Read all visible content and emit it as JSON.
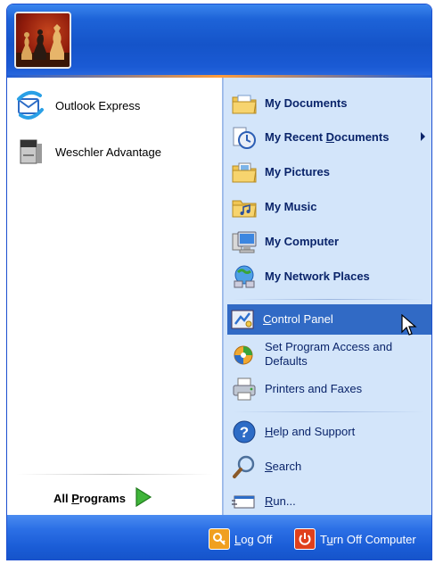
{
  "pinned": [
    {
      "label": "Outlook Express",
      "icon": "outlook-express-icon"
    },
    {
      "label": "Weschler Advantage",
      "icon": "weschler-advantage-icon"
    }
  ],
  "all_programs": {
    "label_prefix": "All ",
    "label_underlined": "P",
    "label_suffix": "rograms"
  },
  "places": [
    {
      "label": "My Documents",
      "icon": "my-documents-folder-icon"
    },
    {
      "label_prefix": "My Recent ",
      "label_underlined": "D",
      "label_suffix": "ocuments",
      "icon": "recent-documents-icon",
      "has_submenu": true
    },
    {
      "label": "My Pictures",
      "icon": "my-pictures-folder-icon"
    },
    {
      "label": "My Music",
      "icon": "my-music-folder-icon"
    },
    {
      "label": "My Computer",
      "icon": "my-computer-icon"
    },
    {
      "label": "My Network Places",
      "icon": "network-places-icon"
    }
  ],
  "settings": [
    {
      "label_underlined": "C",
      "label_suffix": "ontrol Panel",
      "icon": "control-panel-icon",
      "highlighted": true
    },
    {
      "label_line1": "Set Program Access and",
      "label_line2": "Defaults",
      "icon": "program-access-icon"
    },
    {
      "label": "Printers and Faxes",
      "icon": "printer-icon"
    }
  ],
  "support": [
    {
      "label_underlined": "H",
      "label_suffix": "elp and Support",
      "icon": "help-icon"
    },
    {
      "label_underlined": "S",
      "label_suffix": "earch",
      "icon": "search-icon"
    },
    {
      "label_underlined": "R",
      "label_suffix": "un...",
      "icon": "run-icon"
    }
  ],
  "footer": {
    "logoff": {
      "label_underlined": "L",
      "label_suffix": "og Off",
      "icon": "log-off-icon"
    },
    "turnoff": {
      "label_prefix": "T",
      "label_underlined": "u",
      "label_suffix": "rn Off Computer",
      "icon": "power-icon"
    }
  },
  "colors": {
    "header_blue": "#1554c9",
    "right_panel": "#d3e5fa",
    "highlight": "#316ac5",
    "link_text": "#0a246a"
  }
}
